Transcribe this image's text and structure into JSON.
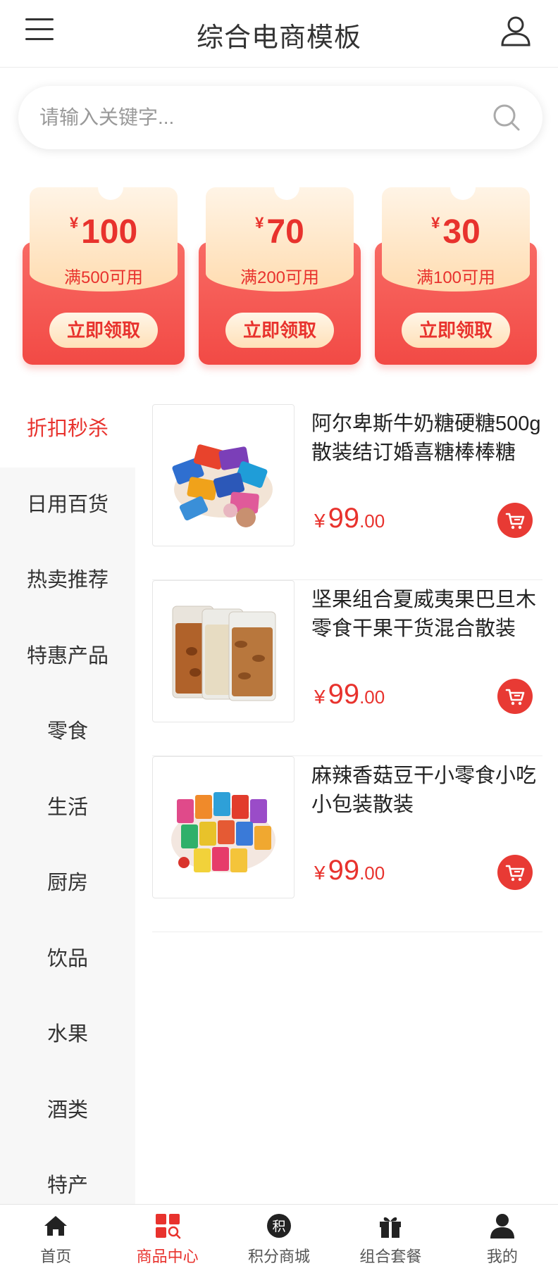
{
  "header": {
    "title": "综合电商模板"
  },
  "search": {
    "placeholder": "请输入关键字..."
  },
  "coupons": [
    {
      "currency": "¥",
      "amount": "100",
      "condition": "满500可用",
      "button": "立即领取"
    },
    {
      "currency": "¥",
      "amount": "70",
      "condition": "满200可用",
      "button": "立即领取"
    },
    {
      "currency": "¥",
      "amount": "30",
      "condition": "满100可用",
      "button": "立即领取"
    }
  ],
  "categories": [
    {
      "label": "折扣秒杀",
      "active": true
    },
    {
      "label": "日用百货"
    },
    {
      "label": "热卖推荐"
    },
    {
      "label": "特惠产品"
    },
    {
      "label": "零食"
    },
    {
      "label": "生活"
    },
    {
      "label": "厨房"
    },
    {
      "label": "饮品"
    },
    {
      "label": "水果"
    },
    {
      "label": "酒类"
    },
    {
      "label": "特产"
    }
  ],
  "products": [
    {
      "name": "阿尔卑斯牛奶糖硬糖500g散装结订婚喜糖棒棒糖",
      "currency": "¥",
      "price_int": "99",
      "price_dec": ".00"
    },
    {
      "name": "坚果组合夏威夷果巴旦木零食干果干货混合散装",
      "currency": "¥",
      "price_int": "99",
      "price_dec": ".00"
    },
    {
      "name": "麻辣香菇豆干小零食小吃小包装散装",
      "currency": "¥",
      "price_int": "99",
      "price_dec": ".00"
    }
  ],
  "tabbar": [
    {
      "label": "首页",
      "icon": "home-icon"
    },
    {
      "label": "商品中心",
      "icon": "grid-search-icon",
      "active": true
    },
    {
      "label": "积分商城",
      "icon": "points-icon",
      "icon_text": "积"
    },
    {
      "label": "组合套餐",
      "icon": "gift-icon"
    },
    {
      "label": "我的",
      "icon": "user-icon"
    }
  ],
  "colors": {
    "accent": "#e8322d",
    "coupon_top": "#ffdcb0",
    "sidebar_bg": "#f7f7f7"
  }
}
